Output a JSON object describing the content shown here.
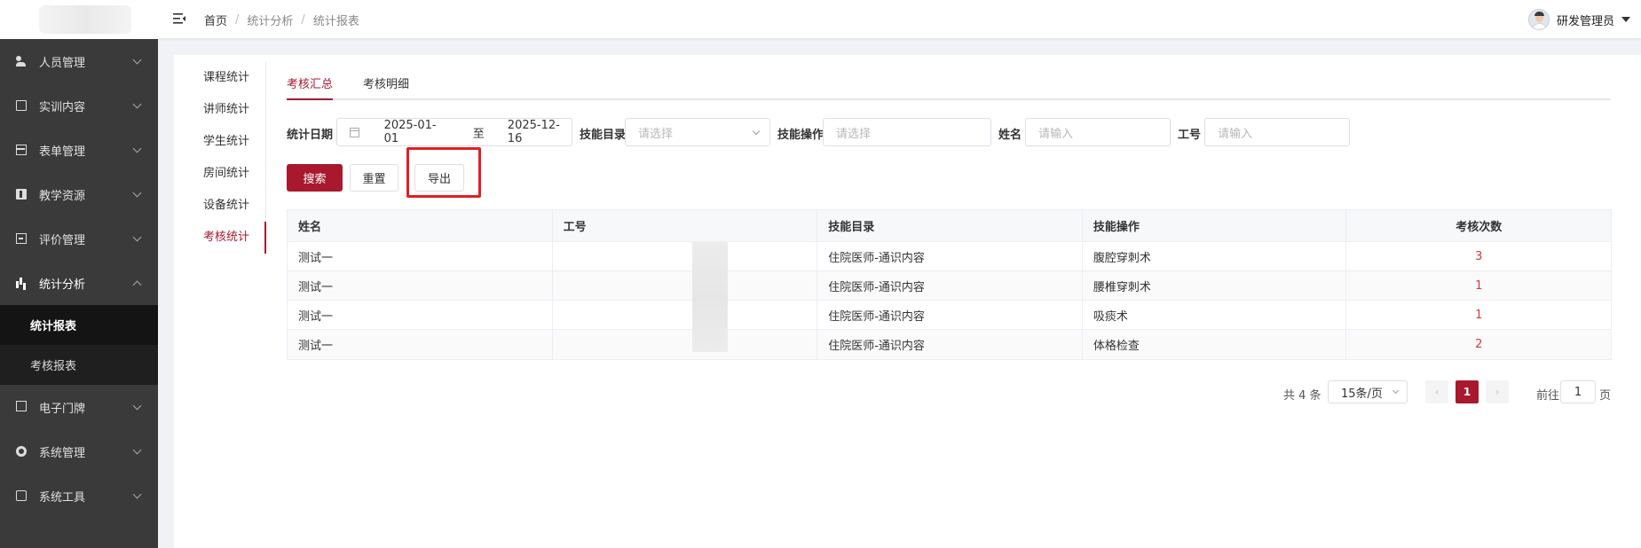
{
  "header": {
    "breadcrumb": [
      "首页",
      "统计分析",
      "统计报表"
    ],
    "user_name": "研发管理员"
  },
  "sidebar": {
    "items": [
      {
        "label": "人员管理",
        "icon": "users-icon"
      },
      {
        "label": "实训内容",
        "icon": "book-icon"
      },
      {
        "label": "表单管理",
        "icon": "table-icon"
      },
      {
        "label": "教学资源",
        "icon": "resource-icon"
      },
      {
        "label": "评价管理",
        "icon": "evaluation-icon"
      },
      {
        "label": "统计分析",
        "icon": "bar-chart-icon"
      },
      {
        "label": "电子门牌",
        "icon": "screen-icon"
      },
      {
        "label": "系统管理",
        "icon": "gear-icon"
      },
      {
        "label": "系统工具",
        "icon": "toolbox-icon"
      }
    ],
    "submenu": [
      "统计报表",
      "考核报表"
    ]
  },
  "vtabs": [
    "课程统计",
    "讲师统计",
    "学生统计",
    "房间统计",
    "设备统计",
    "考核统计"
  ],
  "htabs": [
    "考核汇总",
    "考核明细"
  ],
  "filters": {
    "date_label": "统计日期",
    "date_start": "2025-01-01",
    "date_sep": "至",
    "date_end": "2025-12-16",
    "skill_dir_label": "技能目录",
    "skill_dir_placeholder": "请选择",
    "skill_op_label": "技能操作",
    "skill_op_placeholder": "请选择",
    "name_label": "姓名",
    "name_placeholder": "请输入",
    "id_label": "工号",
    "id_placeholder": "请输入"
  },
  "buttons": {
    "search": "搜索",
    "reset": "重置",
    "export": "导出"
  },
  "table": {
    "headers": [
      "姓名",
      "工号",
      "技能目录",
      "技能操作",
      "考核次数"
    ],
    "rows": [
      {
        "name": "测试一",
        "id": "",
        "dir": "住院医师-通识内容",
        "op": "腹腔穿刺术",
        "count": "3"
      },
      {
        "name": "测试一",
        "id": "",
        "dir": "住院医师-通识内容",
        "op": "腰椎穿刺术",
        "count": "1"
      },
      {
        "name": "测试一",
        "id": "",
        "dir": "住院医师-通识内容",
        "op": "吸痰术",
        "count": "1"
      },
      {
        "name": "测试一",
        "id": "",
        "dir": "住院医师-通识内容",
        "op": "体格检查",
        "count": "2"
      }
    ]
  },
  "pagination": {
    "total": "共 4 条",
    "page_size": "15条/页",
    "prev": "‹",
    "current": "1",
    "next": "›",
    "goto_label": "前往",
    "goto_value": "1",
    "page_suffix": "页"
  },
  "colors": {
    "accent": "#a8192e",
    "sidebar_bg": "#3a3a3a",
    "count_red": "#d9363e",
    "highlight": "#e02020"
  }
}
